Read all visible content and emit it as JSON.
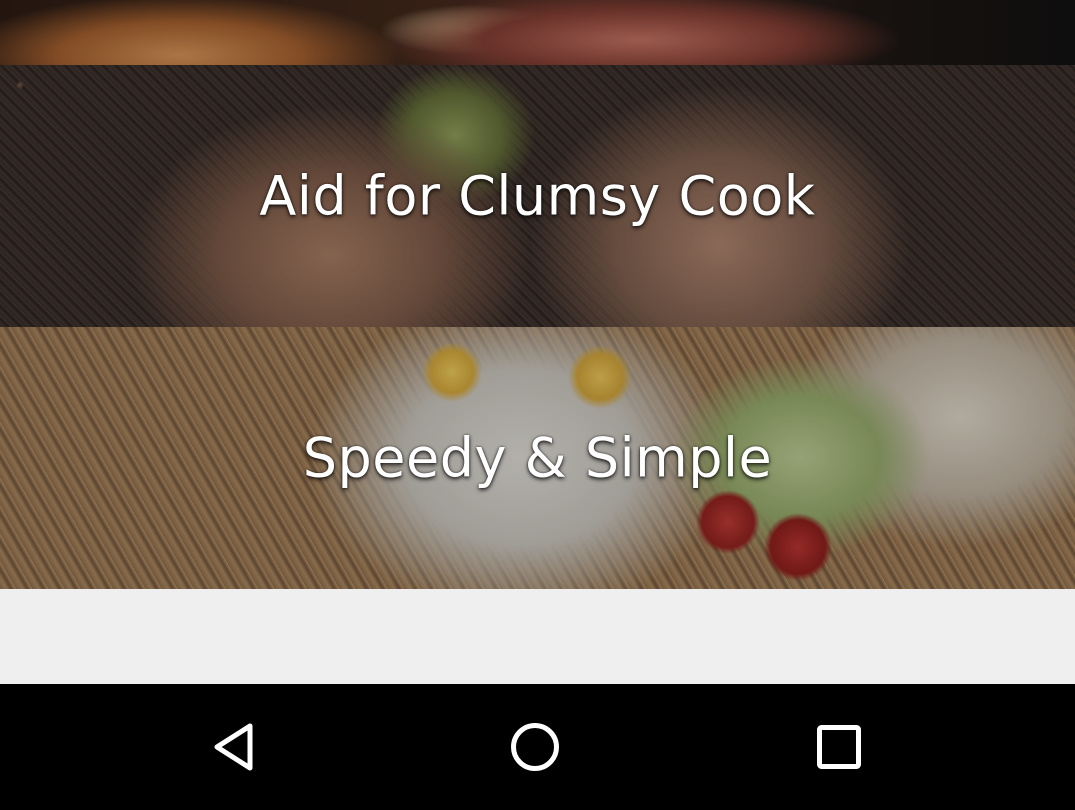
{
  "banners": [
    {
      "id": "top",
      "title": ""
    },
    {
      "id": "clumsy",
      "title": "Aid for Clumsy Cook"
    },
    {
      "id": "speedy",
      "title": "Speedy & Simple"
    }
  ],
  "navigation_bar": {
    "back_icon": "back-triangle-icon",
    "home_icon": "home-circle-icon",
    "recent_icon": "recent-apps-square-icon",
    "icon_color": "#ffffff",
    "background_color": "#000000"
  },
  "colors": {
    "background": "#efefef",
    "banner_title": "#ffffff"
  }
}
